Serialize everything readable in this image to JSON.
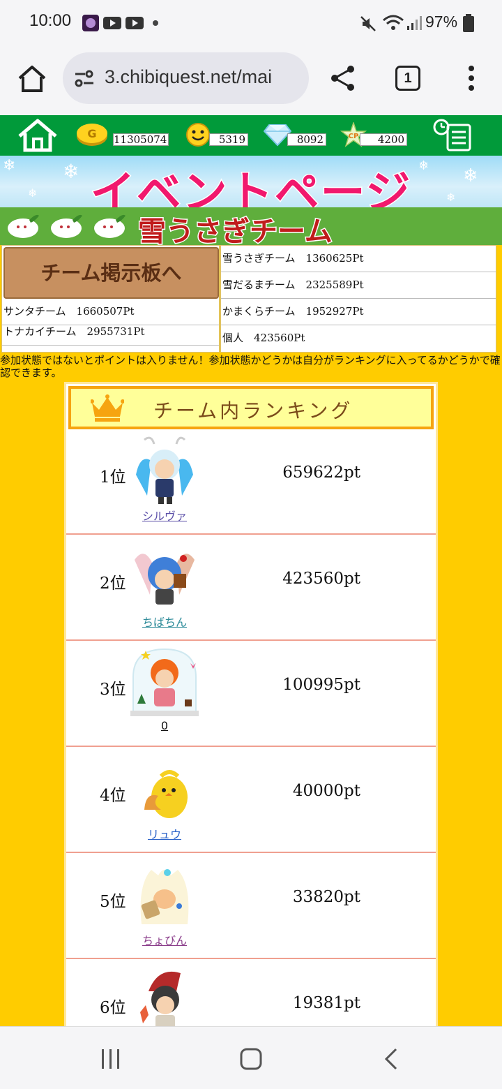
{
  "status": {
    "time": "10:00",
    "battery": "97%"
  },
  "browser": {
    "url": "3.chibiquest.net/mai",
    "tab_count": "1"
  },
  "header": {
    "gold": "11305074",
    "smile": "5319",
    "diamond": "8092",
    "cp": "4200",
    "cp_icon_text": "CP",
    "gold_icon_text": "G"
  },
  "event": {
    "title": "イベントページ",
    "team_title": "雪うさぎチーム"
  },
  "scores": {
    "board_button": "チーム掲示板へ",
    "left": [
      "サンタチーム　1660507Pt",
      "トナカイチーム　2955731Pt"
    ],
    "right": [
      "雪うさぎチーム　1360625Pt",
      "雪だるまチーム　2325589Pt",
      "かまくらチーム　1952927Pt",
      "個人　423560Pt"
    ]
  },
  "notice": "参加状態ではないとポイントは入りません！参加状態かどうかは自分がランキングに入ってるかどうかで確認できます。",
  "ranking": {
    "title": "チーム内ランキング",
    "rows": [
      {
        "rank": "1位",
        "name": "シルヴァ",
        "points": "659622pt",
        "name_color": "#5b4fa8"
      },
      {
        "rank": "2位",
        "name": "ちばちん",
        "points": "423560pt",
        "name_color": "#2f8c9a"
      },
      {
        "rank": "3位",
        "name": "0",
        "points": "100995pt",
        "name_color": "#111111"
      },
      {
        "rank": "4位",
        "name": "リュウ",
        "points": "40000pt",
        "name_color": "#2a62c9"
      },
      {
        "rank": "5位",
        "name": "ちょびん",
        "points": "33820pt",
        "name_color": "#8a3c8a"
      },
      {
        "rank": "6位",
        "name": "",
        "points": "19381pt",
        "name_color": "#111111"
      }
    ]
  }
}
